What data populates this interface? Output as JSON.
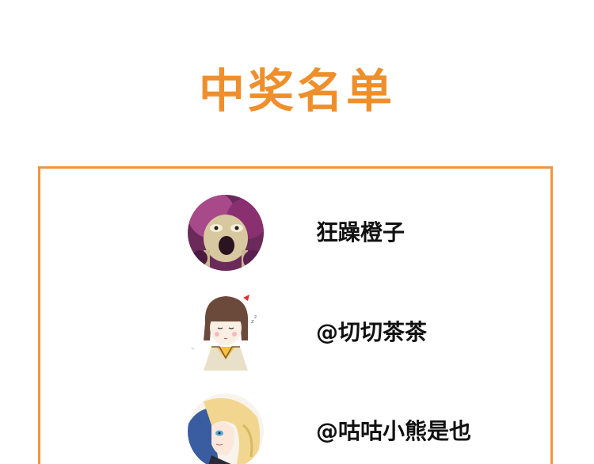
{
  "page": {
    "title": "中奖名单",
    "accent_color": "#f0963c",
    "title_color": "#ee8f2c"
  },
  "winners": [
    {
      "name": "狂躁橙子",
      "avatar_icon": "dark-anime-character-avatar-icon"
    },
    {
      "name": "@切切茶茶",
      "avatar_icon": "sleepy-schoolgirl-avatar-icon"
    },
    {
      "name": "@咕咕小熊是也",
      "avatar_icon": "blonde-anime-character-avatar-icon"
    }
  ]
}
